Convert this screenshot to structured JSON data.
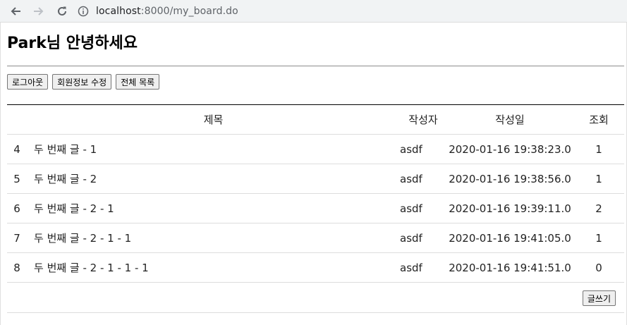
{
  "browser": {
    "url_host": "localhost",
    "url_rest": ":8000/my_board.do"
  },
  "header": {
    "greeting": "Park님 안녕하세요"
  },
  "buttons": {
    "logout": "로그아웃",
    "edit_member": "회원정보 수정",
    "all_list": "전체 목록",
    "write": "글쓰기"
  },
  "table": {
    "headers": {
      "no": "",
      "title": "제목",
      "writer": "작성자",
      "date": "작성일",
      "views": "조회"
    },
    "rows": [
      {
        "no": "4",
        "title": "두 번째 글 - 1",
        "writer": "asdf",
        "date": "2020-01-16 19:38:23.0",
        "views": "1"
      },
      {
        "no": "5",
        "title": "두 번째 글 - 2",
        "writer": "asdf",
        "date": "2020-01-16 19:38:56.0",
        "views": "1"
      },
      {
        "no": "6",
        "title": "두 번째 글 - 2 - 1",
        "writer": "asdf",
        "date": "2020-01-16 19:39:11.0",
        "views": "2"
      },
      {
        "no": "7",
        "title": "두 번째 글 - 2 - 1 - 1",
        "writer": "asdf",
        "date": "2020-01-16 19:41:05.0",
        "views": "1"
      },
      {
        "no": "8",
        "title": "두 번째 글 - 2 - 1 - 1 - 1",
        "writer": "asdf",
        "date": "2020-01-16 19:41:51.0",
        "views": "0"
      }
    ]
  },
  "icons": {
    "back": "arrow-left-icon",
    "forward": "arrow-right-icon",
    "reload": "reload-icon",
    "info": "info-icon"
  }
}
